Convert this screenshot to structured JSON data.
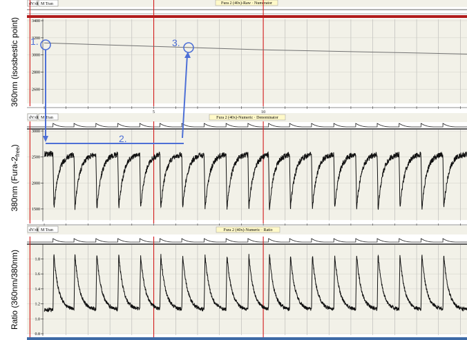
{
  "colors": {
    "background": "#ffffff",
    "panel_bg": "#f2f1e8",
    "grid": "#a9a9a9",
    "marker_red": "#d21a1a",
    "header_bar_red": "#b01c1c",
    "title_bg": "#fff9c9",
    "trace": "#111111",
    "trace_raw": "#707070",
    "annotation": "#4d6fd6"
  },
  "toolbar": {
    "dvdt_label": "dV/dt",
    "mtrans_label": "M Tran"
  },
  "panels": [
    {
      "title": "Fura 2 (40x)-Raw · Numerator",
      "ylabel": "360nm (isosbestic point)"
    },
    {
      "title": "Fura 2 (40x)-Numeric · Denominator",
      "ylabel": "380nm (Fura-2",
      "ylabel_sub": "free",
      "ylabel_end": ")"
    },
    {
      "title": "Fura 2 (40x)-Numeric · Ratio",
      "ylabel": "Ratio (360nm/380nm)"
    }
  ],
  "annotations": {
    "p1": "1.",
    "p2": "2.",
    "p3": "3."
  },
  "chart_data": [
    {
      "type": "line",
      "title": "Fura 2 (40x)-Raw · Numerator",
      "ylabel": "360nm (isosbestic point)",
      "xlim": [
        0,
        19.3
      ],
      "ylim": [
        2450,
        3400
      ],
      "yticks": [
        2600,
        2800,
        3000,
        3200,
        3400
      ],
      "xticks": [
        5,
        10
      ],
      "markers_x": [
        -0.65,
        5,
        10
      ],
      "series": [
        {
          "x": [
            0,
            10,
            19.3
          ],
          "values": [
            3140,
            3060,
            3010
          ]
        }
      ]
    },
    {
      "type": "line",
      "title": "Fura 2 (40x)-Numeric · Denominator",
      "ylabel": "380nm (Fura-2free)",
      "xlim": [
        0,
        19.3
      ],
      "ylim": [
        1300,
        3000
      ],
      "yticks": [
        1500,
        2000,
        2500,
        3000
      ],
      "xticks": [
        5,
        10
      ],
      "markers_x": [
        -0.65,
        5,
        10
      ],
      "pulse_onsets": [
        0.4,
        1.36,
        2.36,
        3.36,
        4.36,
        5.28,
        6.28,
        7.3,
        8.3,
        9.3,
        10.24,
        11.2,
        12.2,
        13.22,
        14.22,
        15.2,
        16.2,
        17.2,
        18.2
      ],
      "baseline": 2560,
      "trough": 1500,
      "decay_tau": 0.22,
      "noise": 55
    },
    {
      "type": "line",
      "title": "Fura 2 (40x)-Numeric · Ratio",
      "ylabel": "Ratio (360nm/380nm)",
      "xlim": [
        0,
        19.3
      ],
      "ylim": [
        0.8,
        1.97
      ],
      "yticks": [
        0.8,
        1.0,
        1.2,
        1.4,
        1.6,
        1.8
      ],
      "xticks": [
        5,
        10
      ],
      "markers_x": [
        -0.65,
        5,
        10
      ],
      "pulse_onsets": [
        0.4,
        1.36,
        2.36,
        3.36,
        4.36,
        5.28,
        6.28,
        7.3,
        8.3,
        9.3,
        10.24,
        11.2,
        12.2,
        13.22,
        14.22,
        15.2,
        16.2,
        17.2,
        18.2
      ],
      "baseline": 1.12,
      "peak": 1.86,
      "decay_tau": 0.22,
      "noise": 0.025
    }
  ]
}
